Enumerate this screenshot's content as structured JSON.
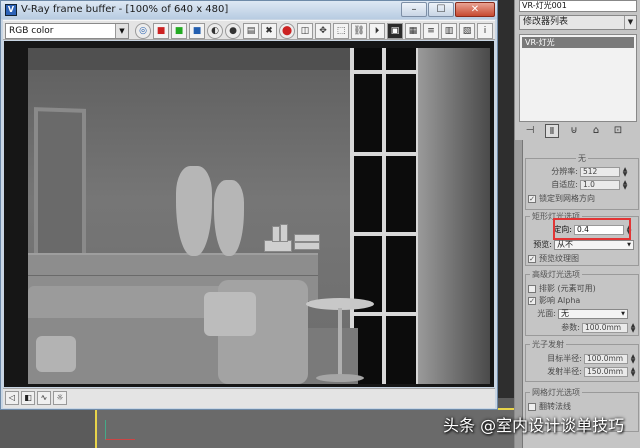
{
  "vfb": {
    "title": "V-Ray frame buffer - [100% of 640 x 480]",
    "title_icon": "V",
    "window_buttons": [
      "–",
      "☐",
      "✕"
    ],
    "channel": "RGB color",
    "toolbar_icons": [
      {
        "name": "color-wheel-icon",
        "glyph": "◎",
        "cls": "blue round"
      },
      {
        "name": "red-channel-icon",
        "glyph": "■",
        "cls": "red sq"
      },
      {
        "name": "green-channel-icon",
        "glyph": "■",
        "cls": "green sq"
      },
      {
        "name": "blue-channel-icon",
        "glyph": "■",
        "cls": "blue sq"
      },
      {
        "name": "alpha-channel-icon",
        "glyph": "◐",
        "cls": "round"
      },
      {
        "name": "mono-icon",
        "glyph": "●",
        "cls": "round"
      },
      {
        "name": "save-image-icon",
        "glyph": "▤",
        "cls": "sq"
      },
      {
        "name": "load-image-icon",
        "glyph": "✖",
        "cls": "sq"
      },
      {
        "name": "clear-image-icon",
        "glyph": "⬤",
        "cls": "red round"
      },
      {
        "name": "duplicate-icon",
        "glyph": "◫",
        "cls": "sq"
      },
      {
        "name": "track-mouse-icon",
        "glyph": "✥",
        "cls": "sq"
      },
      {
        "name": "region-render-icon",
        "glyph": "⬚",
        "cls": "sq"
      },
      {
        "name": "link-icon",
        "glyph": "⛓",
        "cls": "sq"
      },
      {
        "name": "render-last-icon",
        "glyph": "⏵",
        "cls": "sq"
      },
      {
        "name": "display-icon",
        "glyph": "▣",
        "cls": "dark"
      },
      {
        "name": "lut-icon",
        "glyph": "▦",
        "cls": "sq"
      },
      {
        "name": "stamp-icon",
        "glyph": "≡",
        "cls": "sq"
      },
      {
        "name": "levels-icon",
        "glyph": "▥",
        "cls": "sq"
      },
      {
        "name": "pixel-info-icon",
        "glyph": "▧",
        "cls": "sq"
      },
      {
        "name": "info-icon",
        "glyph": "i",
        "cls": "sq"
      }
    ]
  },
  "panel": {
    "object_name": "VR-灯光001",
    "modifier_list": "修改器列表",
    "stack_item": "VR-灯光",
    "tools": [
      "⊣",
      "Ⅱ",
      "⊍",
      "⌂",
      "⊡"
    ],
    "rollout_top": {
      "title": "无",
      "subdivs_label": "分辨率:",
      "subdivs_value": "512",
      "adaptive_label": "自适应:",
      "adaptive_value": "1.0",
      "lock_label": "锁定到网格方向"
    },
    "directional": {
      "title": "矩形灯光选项",
      "label": "定向:",
      "value": "0.4",
      "preview_label": "预览:",
      "preview_value": "从不",
      "texture_label": "预览纹理图"
    },
    "options": {
      "title": "高级灯光选项",
      "shadow_label": "排影 (元素可用)",
      "affect_alpha": "影响 Alpha",
      "photon_label": "光面:",
      "photon_value": "无",
      "radius_label": "参数:",
      "radius_value": "100.0mm"
    },
    "photon": {
      "title": "光子发射",
      "target_label": "目标半径:",
      "target_value": "100.0mm",
      "emit_label": "发射半径:",
      "emit_value": "150.0mm"
    },
    "mesh": {
      "title": "网格灯光选项",
      "flip_label": "翻转法线"
    }
  },
  "watermark": "头条 @室内设计谈单技巧"
}
